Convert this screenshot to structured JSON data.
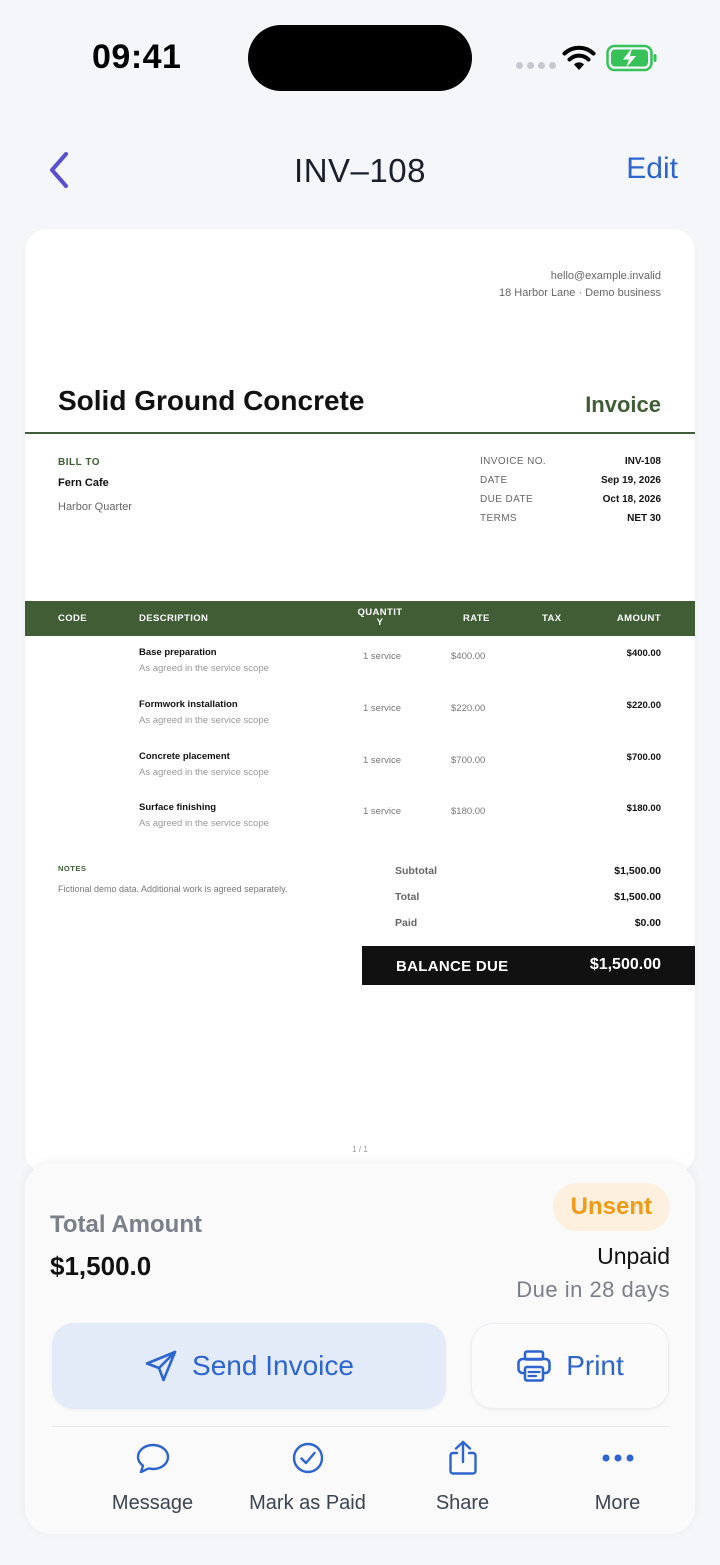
{
  "status_bar": {
    "time": "09:41"
  },
  "nav": {
    "title": "INV–108",
    "edit_label": "Edit"
  },
  "document": {
    "business_email": "hello@example.invalid",
    "business_address": "18 Harbor Lane · Demo business",
    "company_name": "Solid Ground Concrete",
    "doc_type": "Invoice",
    "bill_to_label": "BILL TO",
    "bill_to_name": "Fern Cafe",
    "bill_to_address": "Harbor Quarter",
    "meta": [
      {
        "label": "INVOICE NO.",
        "value": "INV-108"
      },
      {
        "label": "DATE",
        "value": "Sep 19, 2026"
      },
      {
        "label": "DUE DATE",
        "value": "Oct 18, 2026"
      },
      {
        "label": "TERMS",
        "value": "NET 30"
      }
    ],
    "table_headers": {
      "code": "CODE",
      "description": "DESCRIPTION",
      "quantity_1": "QUANTIT",
      "quantity_2": "Y",
      "rate": "RATE",
      "tax": "TAX",
      "amount": "AMOUNT"
    },
    "items": [
      {
        "title": "Base preparation",
        "sub": "As agreed in the service scope",
        "qty": "1 service",
        "rate": "$400.00",
        "amount": "$400.00"
      },
      {
        "title": "Formwork installation",
        "sub": "As agreed in the service scope",
        "qty": "1 service",
        "rate": "$220.00",
        "amount": "$220.00"
      },
      {
        "title": "Concrete placement",
        "sub": "As agreed in the service scope",
        "qty": "1 service",
        "rate": "$700.00",
        "amount": "$700.00"
      },
      {
        "title": "Surface finishing",
        "sub": "As agreed in the service scope",
        "qty": "1 service",
        "rate": "$180.00",
        "amount": "$180.00"
      }
    ],
    "notes_label": "NOTES",
    "notes_text": "Fictional demo data. Additional work is agreed separately.",
    "totals": [
      {
        "label": "Subtotal",
        "value": "$1,500.00"
      },
      {
        "label": "Total",
        "value": "$1,500.00"
      },
      {
        "label": "Paid",
        "value": "$0.00"
      }
    ],
    "balance_label": "BALANCE DUE",
    "balance_value": "$1,500.00",
    "page_number": "1 / 1"
  },
  "summary": {
    "amount_label": "Total Amount",
    "amount_value": "$1,500.0",
    "status_badge": "Unsent",
    "payment_status": "Unpaid",
    "due_text": "Due in 28 days",
    "send_label": "Send Invoice",
    "print_label": "Print"
  },
  "actions": [
    {
      "label": "Message",
      "icon": "message-icon"
    },
    {
      "label": "Mark as Paid",
      "icon": "check-circle-icon"
    },
    {
      "label": "Share",
      "icon": "share-icon"
    },
    {
      "label": "More",
      "icon": "more-icon"
    }
  ],
  "colors": {
    "accent": "#2d64d0",
    "brand_green": "#405d36",
    "badge_orange": "#f09a16",
    "badge_bg": "#fdf0de"
  }
}
